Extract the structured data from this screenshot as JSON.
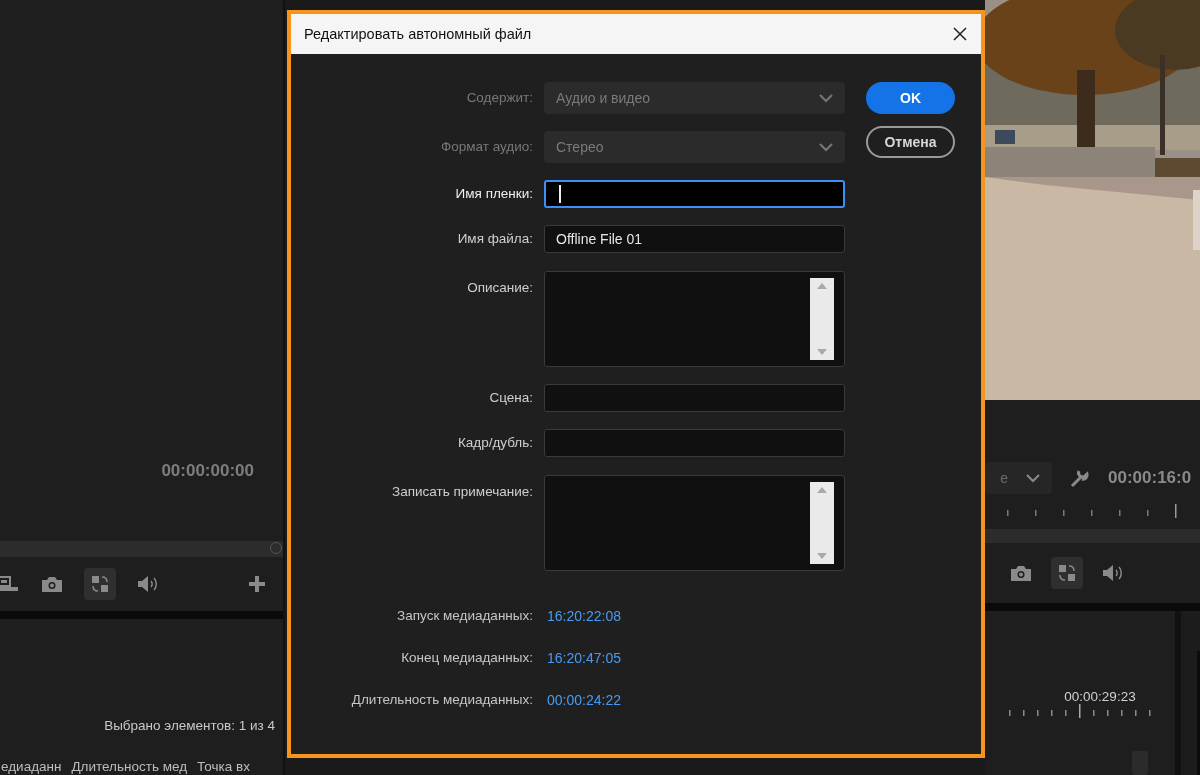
{
  "source_monitor": {
    "timecode": "00:00:00:00",
    "swap_on": true
  },
  "project_panel": {
    "selection_count": "Выбрано элементов: 1 из 4",
    "columns": [
      "едиаданн",
      "Длительность мед",
      "Точка вх"
    ]
  },
  "program_monitor": {
    "zoom_value": "е",
    "timecode": "00:00:16:0",
    "swap_on": true
  },
  "timeline": {
    "timecode": "00:00:29:23"
  },
  "dialog": {
    "title": "Редактировать автономный файл",
    "fields": [
      {
        "label": "Содержит:",
        "kind": "dropdown",
        "value": "Аудио и видео",
        "disabled": true,
        "focused": false
      },
      {
        "label": "Формат аудио:",
        "kind": "dropdown",
        "value": "Стерео",
        "disabled": true,
        "focused": false
      },
      {
        "label": "Имя пленки:",
        "kind": "input",
        "disabled": false,
        "focused": true
      },
      {
        "label": "Имя файла:",
        "kind": "input",
        "value": "Offline File 01",
        "disabled": false,
        "focused": false
      },
      {
        "label": "Описание:",
        "kind": "textarea",
        "disabled": false,
        "focused": false
      },
      {
        "label": "Сцена:",
        "kind": "input",
        "disabled": false,
        "focused": false
      },
      {
        "label": "Кадр/дубль:",
        "kind": "input",
        "disabled": false,
        "focused": false
      },
      {
        "label": "Записать примечание:",
        "kind": "textarea",
        "disabled": false,
        "focused": false
      }
    ],
    "buttons": [
      {
        "label": "OK",
        "kind": "primary"
      },
      {
        "label": "Отмена",
        "kind": "secondary"
      }
    ],
    "info": [
      {
        "label": "Запуск медиаданных:",
        "value": "16:20:22:08"
      },
      {
        "label": "Конец медиаданных:",
        "value": "16:20:47:05"
      },
      {
        "label": "Длительность медиаданных:",
        "value": "00:00:24:22"
      }
    ]
  }
}
